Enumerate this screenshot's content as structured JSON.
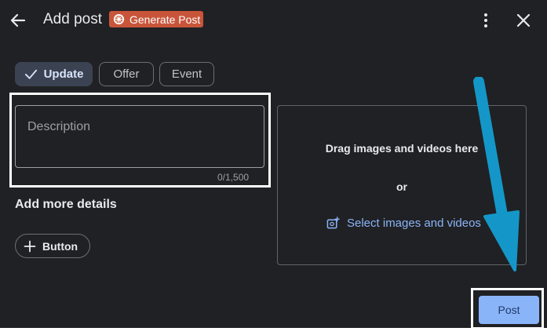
{
  "header": {
    "title": "Add post",
    "generate_label": "Generate Post",
    "icons": {
      "back": "arrow-back-icon",
      "more": "more-vert-icon",
      "close": "close-icon",
      "generate": "sparkle-badge-icon"
    }
  },
  "tabs": [
    {
      "label": "Update",
      "selected": true
    },
    {
      "label": "Offer",
      "selected": false
    },
    {
      "label": "Event",
      "selected": false
    }
  ],
  "description": {
    "placeholder": "Description",
    "value": "",
    "count": "0/1,500"
  },
  "more_details": {
    "heading": "Add more details",
    "button_label": "Button"
  },
  "media": {
    "drag_text": "Drag images and videos here",
    "or_text": "or",
    "select_label": "Select images and videos"
  },
  "footer": {
    "post_label": "Post"
  },
  "colors": {
    "background": "#202124",
    "accent": "#8ab4f8",
    "generate_chip": "#c8553a",
    "annotation_arrow": "#1497c8"
  }
}
